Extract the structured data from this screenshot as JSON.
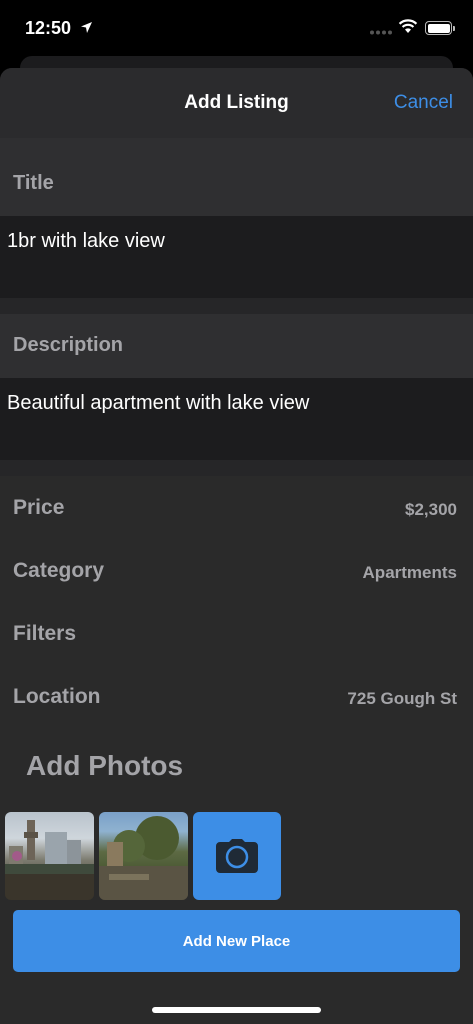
{
  "status_bar": {
    "time": "12:50"
  },
  "nav": {
    "title": "Add Listing",
    "cancel_label": "Cancel"
  },
  "title_section": {
    "label": "Title",
    "value": "1br with lake view"
  },
  "description_section": {
    "label": "Description",
    "value": "Beautiful apartment with lake view"
  },
  "rows": [
    {
      "label": "Price",
      "value": "$2,300"
    },
    {
      "label": "Category",
      "value": "Apartments"
    },
    {
      "label": "Filters",
      "value": ""
    },
    {
      "label": "Location",
      "value": "725 Gough St"
    }
  ],
  "photos": {
    "heading": "Add Photos",
    "camera_icon": "camera-icon"
  },
  "submit": {
    "label": "Add New Place"
  },
  "colors": {
    "accent": "#3d8ee6",
    "background": "#2a2a2a",
    "field": "#1c1c1e",
    "muted_text": "#a4a4a8"
  }
}
